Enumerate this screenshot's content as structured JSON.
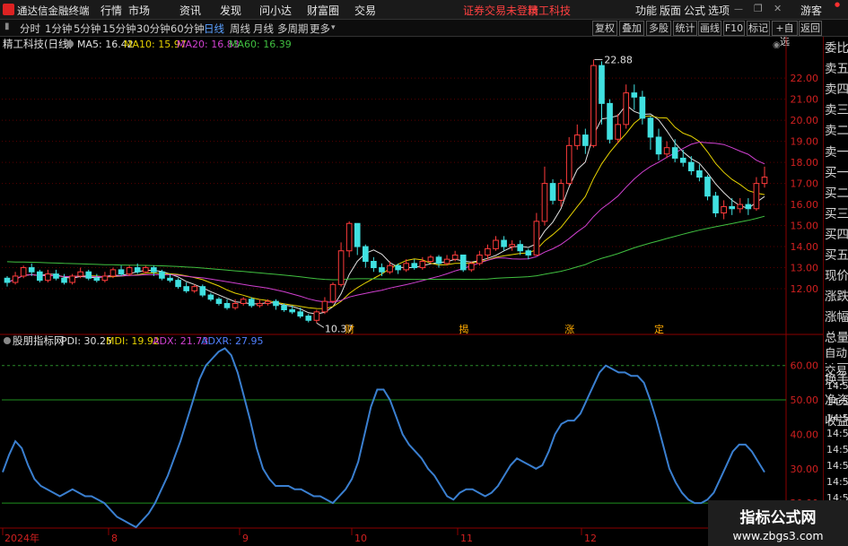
{
  "app": {
    "title": "通达信金融终端",
    "login_status": "证券交易未登录",
    "stock_name": "精工科技",
    "guest": "游客"
  },
  "menu": [
    "行情",
    "市场",
    "资讯",
    "发现",
    "问小达",
    "财富圈",
    "交易"
  ],
  "right_menu": [
    "功能",
    "版面",
    "公式",
    "选项"
  ],
  "periods": [
    "分时",
    "1分钟",
    "5分钟",
    "15分钟",
    "30分钟",
    "60分钟",
    "日线",
    "周线",
    "月线",
    "多周期",
    "更多"
  ],
  "active_period": "日线",
  "right_toolbar": [
    "复权",
    "叠加",
    "多股",
    "统计",
    "画线",
    "F10",
    "标记",
    "+自选",
    "返回"
  ],
  "main_chart": {
    "title": "精工科技(日线)",
    "ma": [
      {
        "label": "MA5: 16.42",
        "color": "#e0e0e0"
      },
      {
        "label": "MA10: 15.97",
        "color": "#e6d200"
      },
      {
        "label": "MA20: 16.83",
        "color": "#d040d0"
      },
      {
        "label": "MA60: 16.39",
        "color": "#40c040"
      }
    ],
    "high_label": "22.88",
    "low_label": "10.37",
    "events": [
      "财",
      "揭",
      "涨",
      "定"
    ]
  },
  "sub_chart": {
    "title": "股朋指标网",
    "indicators": [
      {
        "label": "PDI: 30.25",
        "color": "#e0e0e0"
      },
      {
        "label": "MDI: 19.92",
        "color": "#e6d200"
      },
      {
        "label": "ADX: 21.73",
        "color": "#d040d0"
      },
      {
        "label": "ADXR: 27.95",
        "color": "#5080ff"
      }
    ]
  },
  "x_labels": [
    "2024年",
    "8",
    "9",
    "10",
    "11",
    "12"
  ],
  "side_panel": {
    "items": [
      "委比",
      "卖五",
      "卖四",
      "卖三",
      "卖二",
      "卖一",
      "买一",
      "买二",
      "买三",
      "买四",
      "买五",
      "现价",
      "涨跌",
      "涨幅",
      "总量",
      "外盘",
      "换手",
      "净资",
      "收益"
    ],
    "tabs": [
      "自动",
      "交易"
    ],
    "times": [
      "14:56",
      "14:56",
      "14:56",
      "14:56",
      "14:56",
      "14:56",
      "14:56",
      "14:56",
      "14:56"
    ]
  },
  "chart_data": [
    {
      "type": "candlestick",
      "title": "精工科技(日线)",
      "y_ticks": [
        22.0,
        21.0,
        20.0,
        19.0,
        18.0,
        17.0,
        16.0,
        15.0,
        14.0,
        13.0,
        12.0
      ],
      "ylim": [
        10.0,
        23.2
      ],
      "x_month_labels": [
        "2024年",
        "8",
        "9",
        "10",
        "11",
        "12"
      ],
      "candles": [
        [
          12.5,
          12.3,
          12.6,
          12.1
        ],
        [
          12.3,
          12.6,
          12.8,
          12.2
        ],
        [
          12.6,
          13.0,
          13.1,
          12.5
        ],
        [
          13.0,
          12.8,
          13.2,
          12.6
        ],
        [
          12.8,
          12.4,
          12.9,
          12.3
        ],
        [
          12.4,
          12.7,
          12.9,
          12.3
        ],
        [
          12.7,
          12.5,
          12.9,
          12.4
        ],
        [
          12.5,
          12.3,
          12.7,
          12.2
        ],
        [
          12.3,
          12.6,
          12.7,
          12.2
        ],
        [
          12.6,
          12.8,
          13.0,
          12.5
        ],
        [
          12.8,
          12.5,
          12.9,
          12.4
        ],
        [
          12.5,
          12.4,
          12.7,
          12.3
        ],
        [
          12.4,
          12.6,
          12.8,
          12.3
        ],
        [
          12.6,
          12.9,
          13.0,
          12.5
        ],
        [
          12.9,
          12.7,
          13.1,
          12.6
        ],
        [
          12.7,
          13.0,
          13.1,
          12.6
        ],
        [
          13.0,
          12.8,
          13.2,
          12.7
        ],
        [
          12.8,
          13.0,
          13.1,
          12.7
        ],
        [
          13.0,
          12.8,
          13.1,
          12.6
        ],
        [
          12.8,
          12.5,
          12.9,
          12.4
        ],
        [
          12.5,
          12.4,
          12.7,
          12.3
        ],
        [
          12.4,
          12.1,
          12.5,
          12.0
        ],
        [
          12.1,
          11.9,
          12.3,
          11.8
        ],
        [
          11.9,
          12.1,
          12.2,
          11.8
        ],
        [
          12.1,
          11.7,
          12.2,
          11.6
        ],
        [
          11.7,
          11.5,
          11.8,
          11.4
        ],
        [
          11.5,
          11.3,
          11.6,
          11.2
        ],
        [
          11.3,
          11.1,
          11.5,
          11.0
        ],
        [
          11.1,
          11.3,
          11.5,
          11.0
        ],
        [
          11.3,
          11.5,
          11.6,
          11.2
        ],
        [
          11.5,
          11.2,
          11.6,
          11.1
        ],
        [
          11.2,
          11.3,
          11.5,
          11.1
        ],
        [
          11.3,
          11.4,
          11.5,
          11.2
        ],
        [
          11.4,
          11.2,
          11.5,
          11.0
        ],
        [
          11.2,
          11.0,
          11.3,
          10.9
        ],
        [
          11.0,
          10.9,
          11.2,
          10.8
        ],
        [
          10.9,
          10.7,
          11.1,
          10.6
        ],
        [
          10.7,
          10.5,
          10.8,
          10.4
        ],
        [
          10.5,
          10.9,
          11.0,
          10.37
        ],
        [
          10.9,
          11.4,
          11.6,
          10.8
        ],
        [
          11.4,
          12.2,
          12.3,
          11.3
        ],
        [
          12.2,
          13.8,
          14.2,
          12.1
        ],
        [
          13.8,
          15.1,
          15.2,
          13.5
        ],
        [
          15.1,
          14.0,
          15.1,
          13.6
        ],
        [
          14.0,
          13.3,
          14.1,
          13.0
        ],
        [
          13.3,
          13.0,
          13.5,
          12.8
        ],
        [
          13.0,
          12.8,
          13.2,
          12.6
        ],
        [
          12.8,
          13.1,
          13.3,
          12.7
        ],
        [
          13.1,
          12.9,
          13.2,
          12.7
        ],
        [
          12.9,
          13.2,
          13.4,
          12.8
        ],
        [
          13.2,
          13.0,
          13.4,
          12.9
        ],
        [
          13.0,
          13.3,
          13.5,
          12.9
        ],
        [
          13.3,
          13.5,
          13.6,
          13.2
        ],
        [
          13.5,
          13.2,
          13.6,
          13.0
        ],
        [
          13.2,
          13.4,
          13.6,
          13.1
        ],
        [
          13.4,
          13.6,
          13.8,
          13.3
        ],
        [
          13.6,
          12.9,
          13.6,
          12.8
        ],
        [
          12.9,
          13.2,
          13.3,
          12.8
        ],
        [
          13.2,
          13.6,
          13.8,
          13.1
        ],
        [
          13.6,
          13.9,
          14.1,
          13.4
        ],
        [
          13.9,
          14.3,
          14.5,
          13.8
        ],
        [
          14.3,
          14.0,
          14.5,
          13.8
        ],
        [
          14.0,
          14.1,
          14.3,
          13.8
        ],
        [
          14.1,
          13.8,
          14.3,
          13.6
        ],
        [
          13.8,
          13.6,
          13.9,
          13.4
        ],
        [
          13.6,
          15.2,
          15.6,
          13.6
        ],
        [
          15.2,
          17.0,
          17.8,
          15.0
        ],
        [
          17.0,
          16.2,
          17.2,
          16.0
        ],
        [
          16.2,
          17.0,
          17.2,
          15.9
        ],
        [
          17.0,
          18.8,
          19.2,
          16.9
        ],
        [
          18.8,
          19.3,
          19.8,
          18.6
        ],
        [
          19.3,
          18.8,
          19.6,
          18.4
        ],
        [
          18.8,
          22.6,
          22.88,
          18.7
        ],
        [
          22.6,
          20.8,
          22.8,
          19.8
        ],
        [
          20.8,
          19.1,
          21.0,
          18.9
        ],
        [
          19.1,
          19.8,
          20.3,
          18.9
        ],
        [
          19.8,
          21.3,
          21.7,
          19.6
        ],
        [
          21.3,
          21.1,
          21.7,
          20.5
        ],
        [
          21.1,
          20.1,
          21.4,
          19.8
        ],
        [
          20.1,
          19.2,
          20.2,
          18.6
        ],
        [
          19.2,
          18.4,
          19.6,
          18.1
        ],
        [
          18.4,
          18.7,
          19.0,
          18.2
        ],
        [
          18.7,
          18.2,
          19.1,
          18.0
        ],
        [
          18.2,
          18.0,
          18.6,
          17.8
        ],
        [
          18.0,
          17.6,
          18.3,
          17.4
        ],
        [
          17.6,
          17.3,
          17.9,
          17.1
        ],
        [
          17.3,
          16.4,
          17.4,
          16.2
        ],
        [
          16.4,
          15.6,
          16.6,
          15.4
        ],
        [
          15.6,
          15.9,
          16.2,
          15.3
        ],
        [
          15.9,
          15.8,
          16.3,
          15.5
        ],
        [
          15.8,
          16.0,
          16.3,
          15.6
        ],
        [
          16.0,
          15.8,
          16.3,
          15.5
        ],
        [
          15.8,
          17.0,
          17.3,
          15.7
        ],
        [
          17.0,
          17.3,
          17.8,
          16.8
        ]
      ],
      "events": [
        {
          "label": "财",
          "index": 42
        },
        {
          "label": "揭",
          "index": 56
        },
        {
          "label": "涨",
          "index": 69
        },
        {
          "label": "定",
          "index": 80
        }
      ],
      "ma_last": {
        "MA5": 16.42,
        "MA10": 15.97,
        "MA20": 16.83,
        "MA60": 16.39
      }
    },
    {
      "type": "line",
      "title": "股朋指标网",
      "y_ticks": [
        60.0,
        50.0,
        40.0,
        30.0,
        20.0
      ],
      "ylim": [
        13,
        68
      ],
      "reference_lines": [
        60,
        50,
        20
      ],
      "series": [
        {
          "name": "ADXR",
          "values": [
            29,
            34,
            38,
            36,
            31,
            27,
            25,
            24,
            23,
            22,
            23,
            24,
            23,
            22,
            22,
            21,
            20,
            18,
            16,
            15,
            14,
            13,
            15,
            17,
            20,
            24,
            28,
            33,
            38,
            44,
            50,
            56,
            60,
            62,
            64,
            65,
            63,
            58,
            51,
            44,
            36,
            30,
            27,
            25,
            25,
            25,
            24,
            24,
            23,
            22,
            22,
            21,
            20,
            22,
            24,
            27,
            32,
            40,
            48,
            53,
            53,
            50,
            45,
            40,
            37,
            35,
            33,
            30,
            28,
            25,
            22,
            21,
            23,
            24,
            24,
            23,
            22,
            23,
            25,
            28,
            31,
            33,
            32,
            31,
            30,
            31,
            35,
            40,
            43,
            44,
            44,
            46,
            50,
            54,
            58,
            60,
            59,
            58,
            58,
            57,
            57,
            55,
            50,
            44,
            37,
            30,
            26,
            23,
            21,
            20,
            20,
            21,
            23,
            27,
            31,
            35,
            37,
            37,
            35,
            32,
            29
          ]
        }
      ],
      "last_values": {
        "PDI": 30.25,
        "MDI": 19.92,
        "ADX": 21.73,
        "ADXR": 27.95
      }
    }
  ],
  "watermark": {
    "title": "指标公式网",
    "url": "www.zbgs3.com"
  }
}
